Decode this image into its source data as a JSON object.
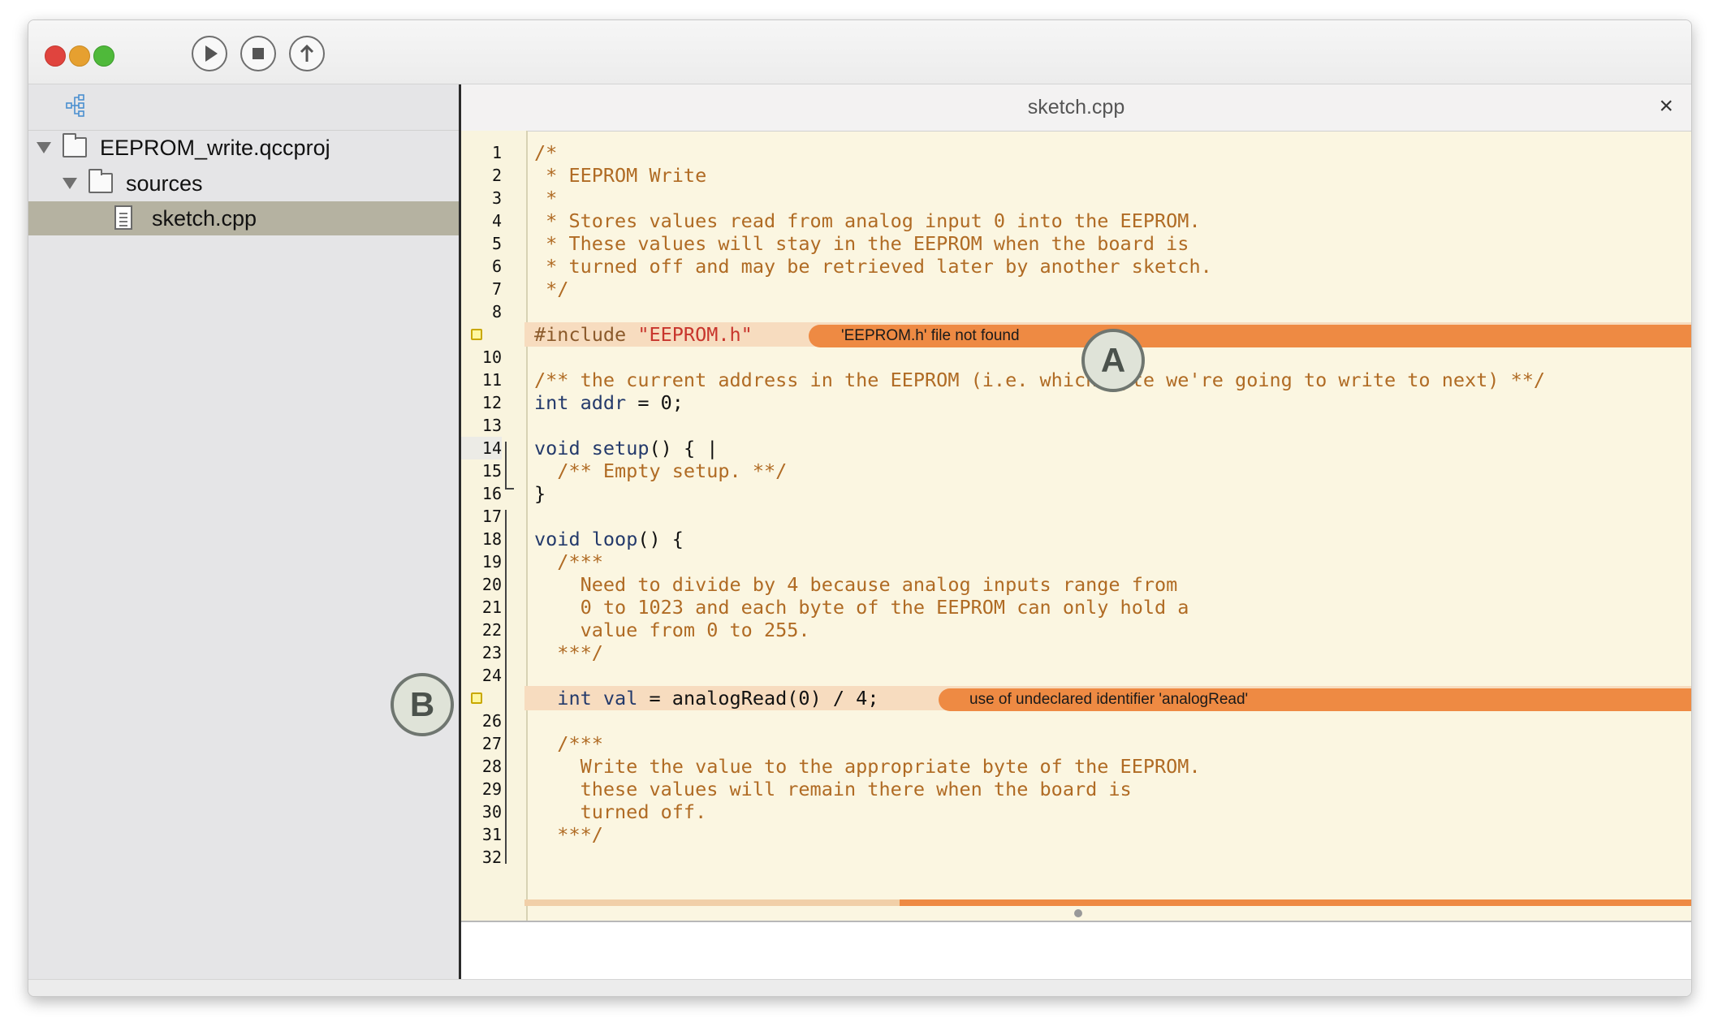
{
  "toolbar": {
    "traffic_lights": {
      "close_color": "#e0443e",
      "minimize_color": "#e6a030",
      "zoom_color": "#4fb93a"
    },
    "buttons": [
      {
        "icon": "play-icon"
      },
      {
        "icon": "stop-icon"
      },
      {
        "icon": "upload-icon"
      }
    ]
  },
  "sidebar": {
    "header_icon": "project-tree-icon",
    "tree": [
      {
        "label": "EEPROM_write.qccproj",
        "icon": "folder-icon",
        "level": 0,
        "expanded": true
      },
      {
        "label": "sources",
        "icon": "folder-icon",
        "level": 1,
        "expanded": true
      },
      {
        "label": "sketch.cpp",
        "icon": "file-icon",
        "level": 2,
        "selected": true
      }
    ]
  },
  "editor": {
    "tab_title": "sketch.cpp",
    "close_glyph": "×",
    "line_numbers": [
      "1",
      "2",
      "3",
      "4",
      "5",
      "6",
      "7",
      "8",
      "",
      "10",
      "11",
      "12",
      "13",
      "14",
      "15",
      "16",
      "17",
      "18",
      "19",
      "20",
      "21",
      "22",
      "23",
      "24",
      "",
      "26",
      "27",
      "28",
      "29",
      "30",
      "31",
      "32"
    ],
    "code": {
      "l1": "/*",
      "l2": " * EEPROM Write",
      "l3": " *",
      "l4": " * Stores values read from analog input 0 into the EEPROM.",
      "l5": " * These values will stay in the EEPROM when the board is",
      "l6": " * turned off and may be retrieved later by another sketch.",
      "l7": " */",
      "l9_directive": "#include",
      "l9_string": "\"EEPROM.h\"",
      "l11": "/** the current address in the EEPROM (i.e. which byte we're going to write to next) **/",
      "l12_kw": "int",
      "l12_var": "addr",
      "l12_rest": " = 0;",
      "l14_kw": "void",
      "l14_fn": "setup",
      "l14_rest": "() { |",
      "l15": "  /** Empty setup. **/",
      "l16": "}",
      "l18_kw": "void",
      "l18_fn": "loop",
      "l18_rest": "() {",
      "l19": "  /***",
      "l20": "    Need to divide by 4 because analog inputs range from",
      "l21": "    0 to 1023 and each byte of the EEPROM can only hold a",
      "l22": "    value from 0 to 255.",
      "l23": "  ***/",
      "l25_kw": "int",
      "l25_var": "val",
      "l25_rest": " = analogRead(0) / 4;",
      "l27": "  /***",
      "l28": "    Write the value to the appropriate byte of the EEPROM.",
      "l29": "    these values will remain there when the board is",
      "l30": "    turned off.",
      "l31": "  ***/"
    },
    "errors": [
      {
        "line": 9,
        "message": "'EEPROM.h' file not found",
        "color": "#ee8a43"
      },
      {
        "line": 25,
        "message": "use of undeclared identifier 'analogRead'",
        "color": "#ee8a43"
      }
    ],
    "callouts": {
      "a": "A",
      "b": "B"
    }
  }
}
